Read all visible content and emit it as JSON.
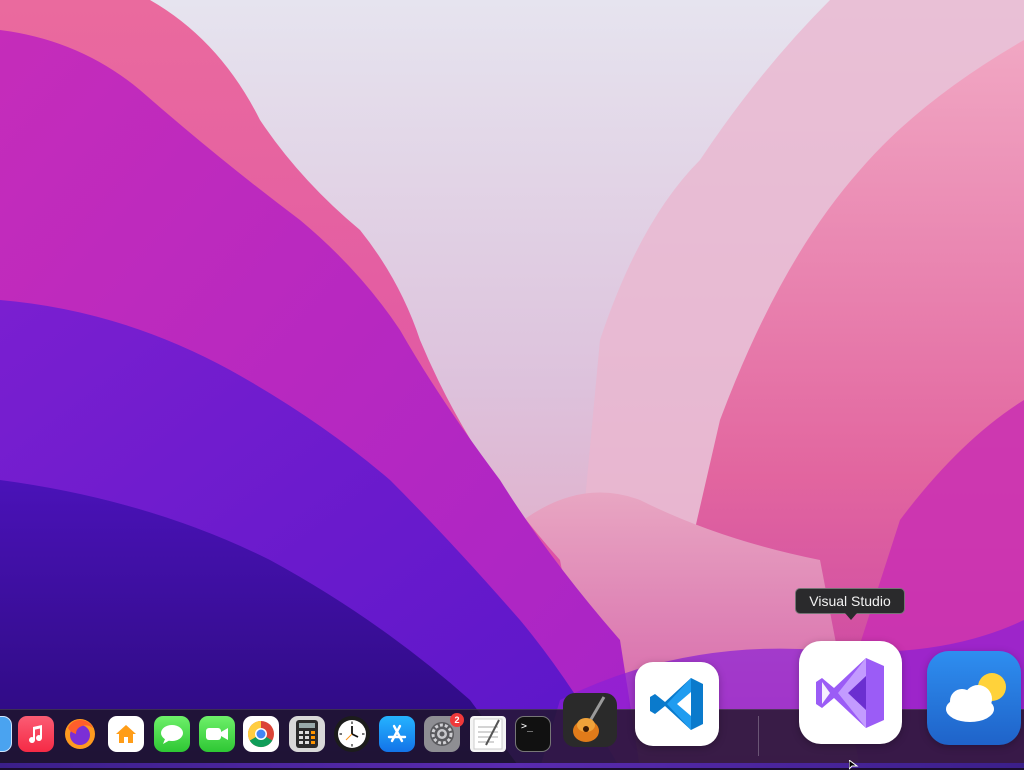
{
  "tooltip": {
    "text": "Visual Studio"
  },
  "dock": {
    "items": [
      {
        "name": "finder",
        "icon": "finder-icon"
      },
      {
        "name": "music",
        "icon": "music-icon"
      },
      {
        "name": "firefox",
        "icon": "firefox-icon"
      },
      {
        "name": "home",
        "icon": "home-icon"
      },
      {
        "name": "messages",
        "icon": "messages-icon"
      },
      {
        "name": "facetime",
        "icon": "facetime-icon"
      },
      {
        "name": "chrome",
        "icon": "chrome-icon"
      },
      {
        "name": "calculator",
        "icon": "calculator-icon"
      },
      {
        "name": "clock",
        "icon": "clock-icon"
      },
      {
        "name": "app-store",
        "icon": "app-store-icon"
      },
      {
        "name": "system-preferences",
        "icon": "gear-icon",
        "badge": "2"
      },
      {
        "name": "textedit",
        "icon": "textedit-icon"
      },
      {
        "name": "terminal",
        "icon": "terminal-icon",
        "prompt": ">_"
      },
      {
        "name": "garageband",
        "icon": "guitar-icon"
      },
      {
        "name": "vscode",
        "icon": "vscode-icon"
      },
      {
        "name": "visual-studio",
        "icon": "visual-studio-icon"
      },
      {
        "name": "weather",
        "icon": "weather-icon"
      }
    ]
  },
  "colors": {
    "accent_purple": "#9b5cf6",
    "vscode_blue": "#0a7acc",
    "badge_red": "#f0393a"
  }
}
